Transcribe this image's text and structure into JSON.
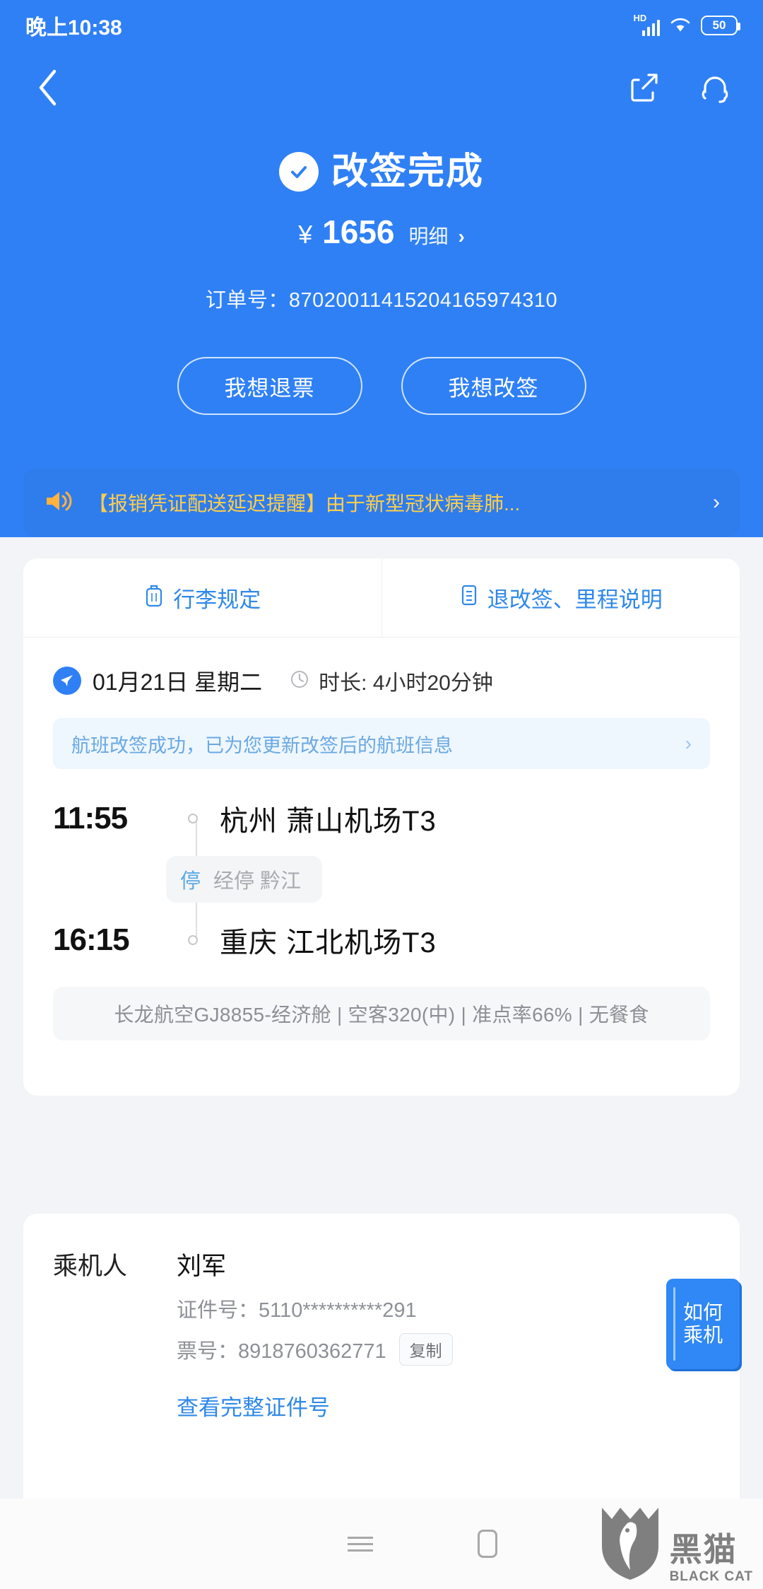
{
  "status_bar": {
    "time": "晚上10:38",
    "hd_label": "HD",
    "battery_level": "50"
  },
  "nav": {
    "back_icon": "back-chevron-icon",
    "share_icon": "share-icon",
    "service_icon": "headset-icon"
  },
  "hero": {
    "status_title": "改签完成",
    "currency": "¥",
    "price": "1656",
    "detail_label": "明细",
    "detail_chevron": "›",
    "order_label": "订单号：",
    "order_number": "87020011415204165974310"
  },
  "actions": {
    "refund": "我想退票",
    "rebook": "我想改签"
  },
  "notice": {
    "icon": "speaker-icon",
    "text": "【报销凭证配送延迟提醒】由于新型冠状病毒肺...",
    "chevron": "›"
  },
  "flight_card": {
    "tabs": [
      {
        "label": "行李规定",
        "icon": "luggage-icon"
      },
      {
        "label": "退改签、里程说明",
        "icon": "document-icon"
      }
    ],
    "date": "01月21日  星期二",
    "duration": "时长: 4小时20分钟",
    "rebook_tip": "航班改签成功，已为您更新改签后的航班信息",
    "rebook_tip_chevron": "›",
    "departure": {
      "time": "11:55",
      "city": "杭州  萧山机场T3"
    },
    "stopover": {
      "badge": "停",
      "text": "经停 黔江"
    },
    "arrival": {
      "time": "16:15",
      "city": "重庆  江北机场T3"
    },
    "meta": "长龙航空GJ8855-经济舱 | 空客320(中) | 准点率66% | 无餐食"
  },
  "passenger": {
    "label": "乘机人",
    "name": "刘军",
    "id_line": "证件号：5110**********291",
    "ticket_line": "票号：8918760362771",
    "copy_label": "复制",
    "full_id_link": "查看完整证件号",
    "howto_line1": "如何",
    "howto_line2": "乘机"
  },
  "bottom_nav": {
    "menu_icon": "hamburger-icon",
    "home_icon": "home-square-icon",
    "back_icon": "back-chevron-icon"
  },
  "watermark": {
    "cn": "黑猫",
    "en": "BLACK CAT"
  },
  "colors": {
    "brand_blue": "#2f80f5",
    "notice_yellow": "#ffcf4a",
    "link_blue": "#2f88e8",
    "page_gray": "#f2f4f7"
  }
}
